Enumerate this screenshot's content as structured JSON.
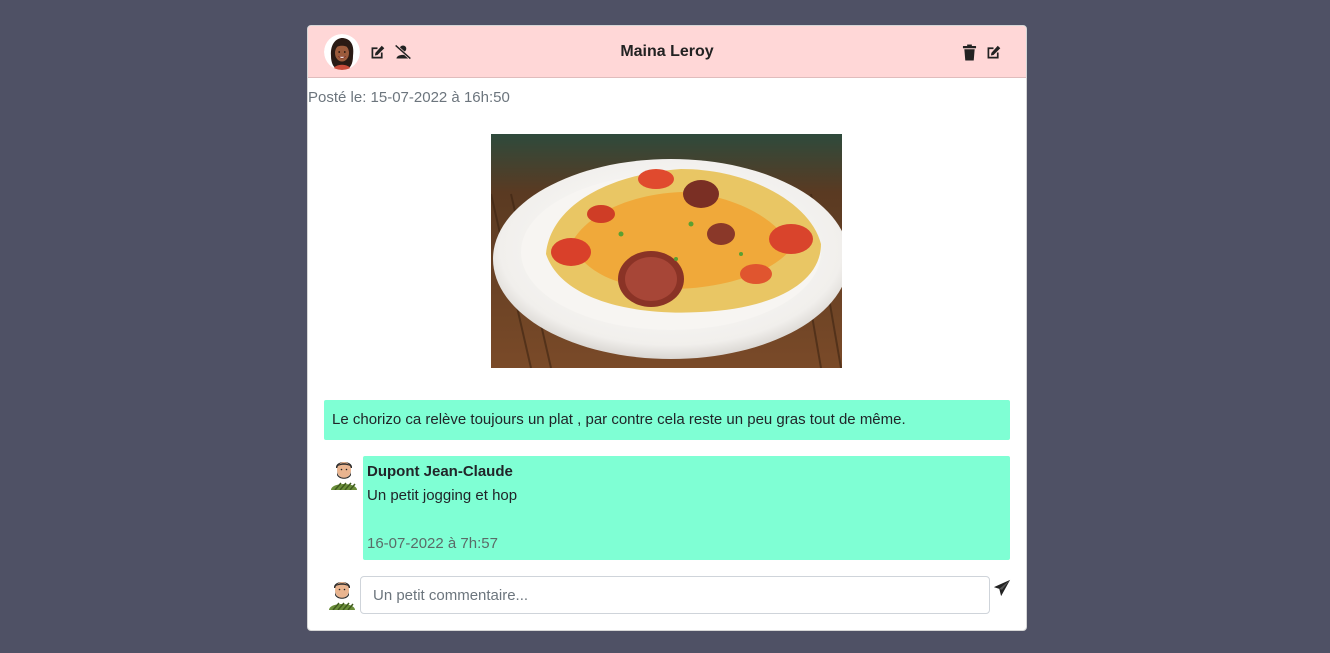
{
  "post": {
    "author": "Maina Leroy",
    "posted_at": "Posté le: 15-07-2022 à 16h:50",
    "text": "Le chorizo ca relève toujours un plat , par contre cela reste un peu gras tout de même.",
    "image_subject": "plate-of-chorizo-omelette"
  },
  "header_icons": {
    "left": [
      "edit-icon",
      "user-slash-icon"
    ],
    "right": [
      "trash-icon",
      "edit-icon"
    ]
  },
  "comments": [
    {
      "author": "Dupont Jean-Claude",
      "text": "Un petit jogging et hop",
      "date": "16-07-2022 à 7h:57"
    }
  ],
  "new_comment": {
    "placeholder": "Un petit commentaire...",
    "value": ""
  },
  "colors": {
    "background": "#4f5165",
    "header": "#ffd7d7",
    "bubble": "#7fffd4"
  }
}
